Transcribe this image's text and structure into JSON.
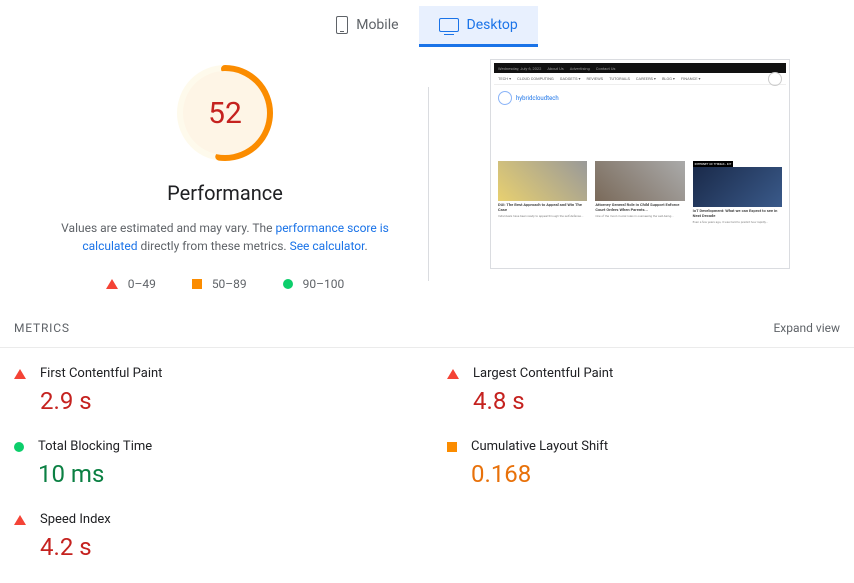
{
  "tabs": {
    "mobile": "Mobile",
    "desktop": "Desktop",
    "active": "desktop"
  },
  "score": {
    "value": "52",
    "label": "Performance",
    "percent": 52
  },
  "disclaimer": {
    "prefix": "Values are estimated and may vary. The ",
    "link1": "performance score is calculated",
    "mid": " directly from these metrics. ",
    "link2": "See calculator"
  },
  "legend": {
    "red": "0–49",
    "orange": "50–89",
    "green": "90–100"
  },
  "preview": {
    "topbar": [
      "Wednesday, July 6, 2022",
      "About Us",
      "Advertising",
      "Contact Us"
    ],
    "nav": [
      "TECH ▾",
      "CLOUD COMPUTING",
      "GADGETS ▾",
      "REVIEWS",
      "TUTORIALS",
      "CAREERS ▾",
      "BLOG ▾",
      "FINANCE ▾"
    ],
    "brand": "hybridcloudtech",
    "cards": [
      {
        "tag": "",
        "title": "DUI: The Best Approach to Appeal and Win The Case",
        "desc": "Individuals have been ready to appeal through the self-defense..."
      },
      {
        "tag": "",
        "title": "Attorney General Role in Child Support Enforce Court Orders When Parents...",
        "desc": "One of the most crucial roles in overseeing the well-being..."
      },
      {
        "tag": "INTERNET OF THINGS - IOT",
        "title": "IoT Development: What we can Expect to see in Next Decade",
        "desc": "Even a few years ago, it was hard to predict how rapidly..."
      }
    ]
  },
  "metricsHeader": {
    "title": "METRICS",
    "expand": "Expand view"
  },
  "metrics": {
    "fcp": {
      "name": "First Contentful Paint",
      "value": "2.9 s",
      "status": "red"
    },
    "lcp": {
      "name": "Largest Contentful Paint",
      "value": "4.8 s",
      "status": "red"
    },
    "tbt": {
      "name": "Total Blocking Time",
      "value": "10 ms",
      "status": "green"
    },
    "cls": {
      "name": "Cumulative Layout Shift",
      "value": "0.168",
      "status": "orange"
    },
    "si": {
      "name": "Speed Index",
      "value": "4.2 s",
      "status": "red"
    }
  }
}
